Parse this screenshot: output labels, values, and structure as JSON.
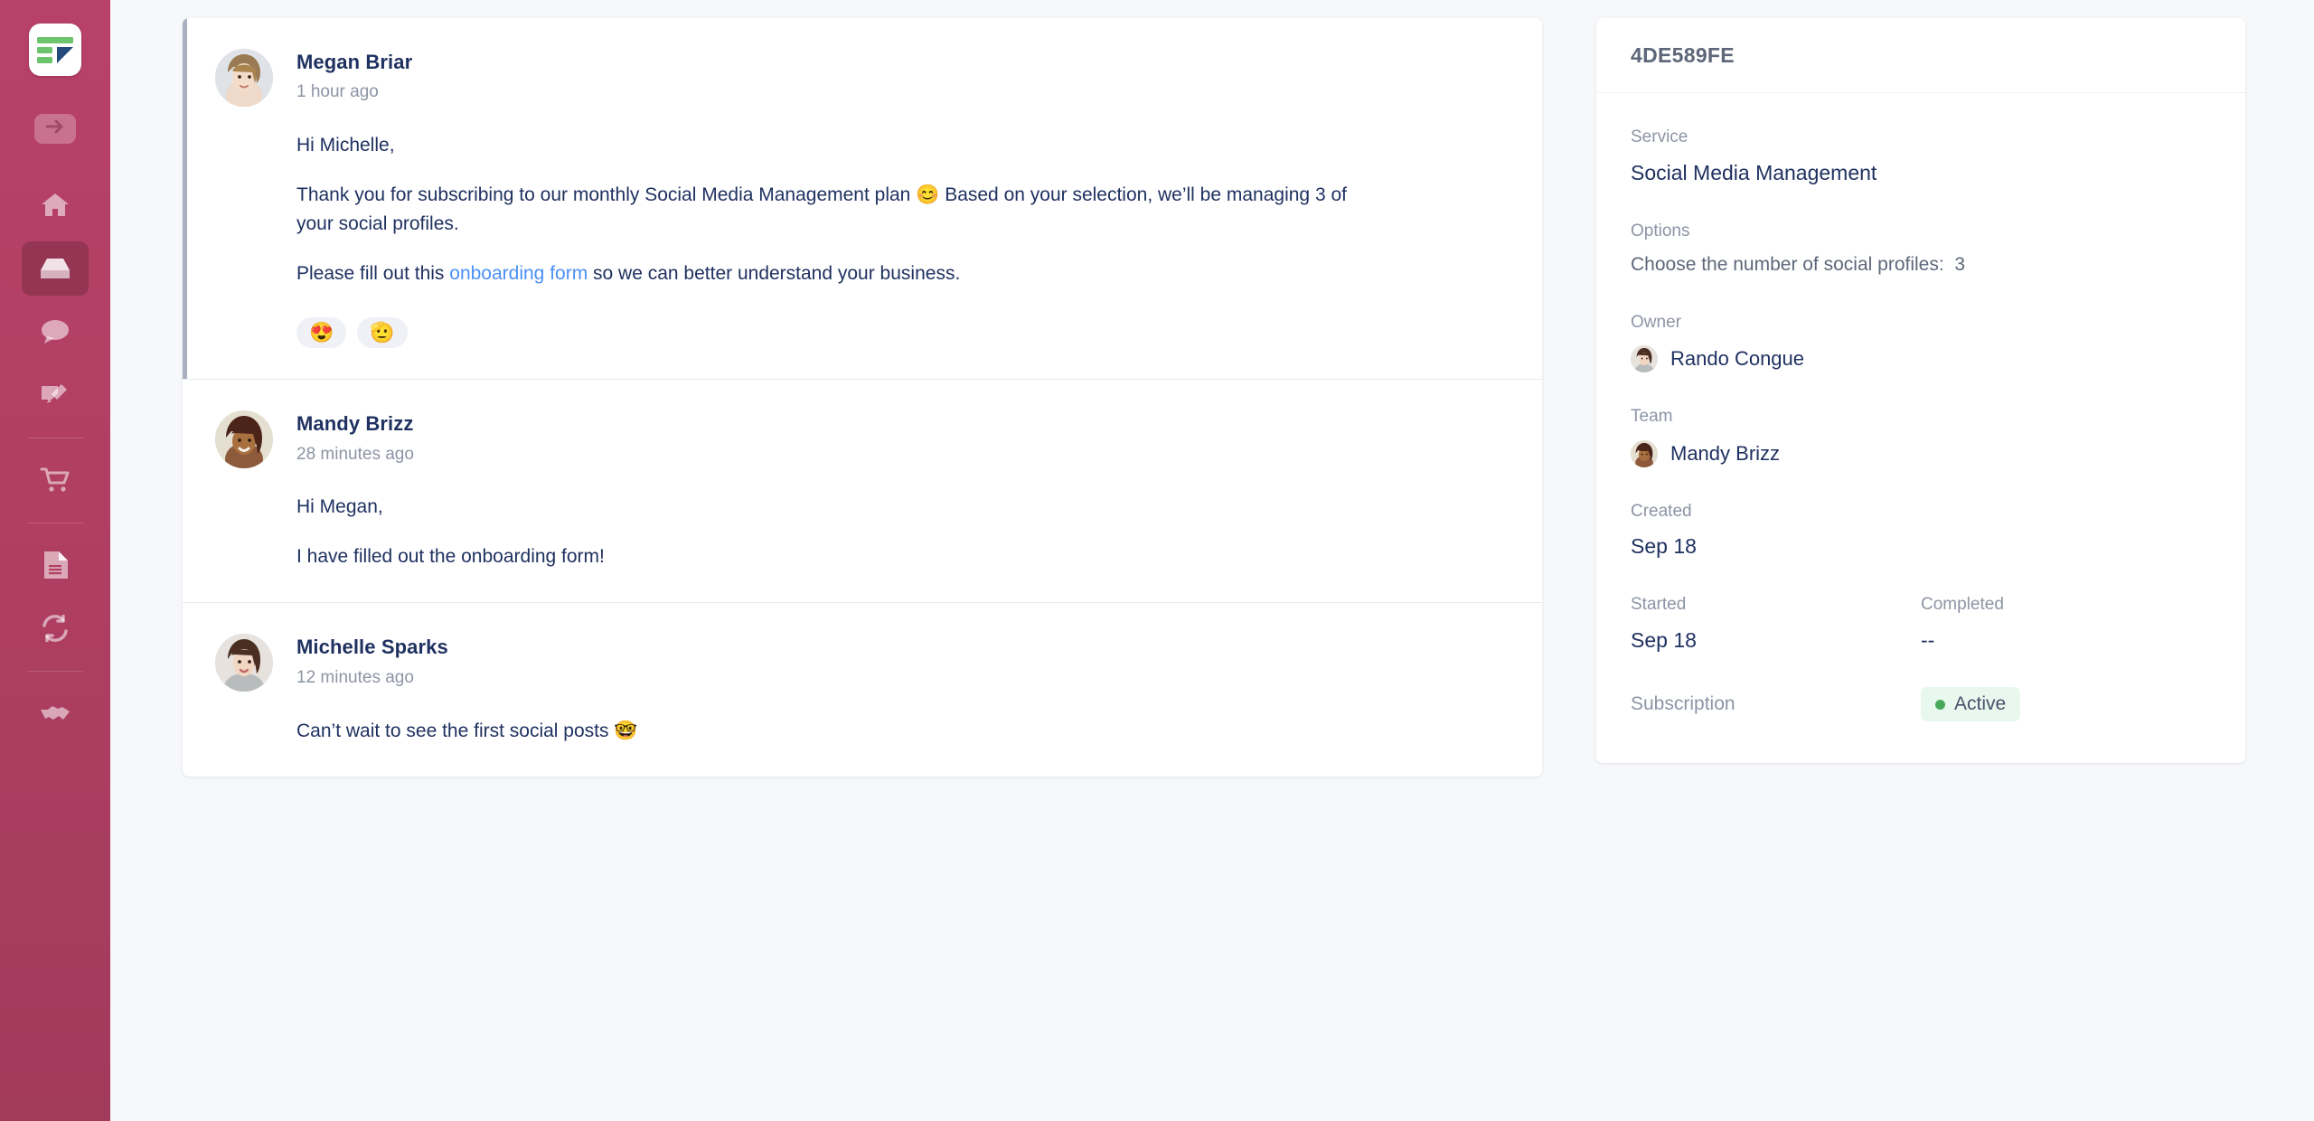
{
  "brand": {
    "accent_sidebar": "#b03f63",
    "logo_green": "#6cc46c",
    "logo_blue": "#23497d",
    "link_blue": "#4a90f4",
    "status_green": "#49a95a",
    "text_navy": "#1f3160"
  },
  "sidebar": {
    "logo_name": "app-logo",
    "items": [
      {
        "icon": "arrow-right-icon",
        "name": "collapse-toggle"
      },
      {
        "icon": "home-icon",
        "name": "sidebar-item-home",
        "active": false
      },
      {
        "icon": "inbox-icon",
        "name": "sidebar-item-inbox",
        "active": true
      },
      {
        "icon": "chat-bubble-icon",
        "name": "sidebar-item-messages",
        "active": false
      },
      {
        "icon": "signature-icon",
        "name": "sidebar-item-forms",
        "active": false
      },
      {
        "icon": "shopping-cart-icon",
        "name": "sidebar-item-orders",
        "active": false
      },
      {
        "icon": "document-icon",
        "name": "sidebar-item-documents",
        "active": false
      },
      {
        "icon": "sync-icon",
        "name": "sidebar-item-subscriptions",
        "active": false
      },
      {
        "icon": "handshake-icon",
        "name": "sidebar-item-partners",
        "active": false
      }
    ]
  },
  "thread": {
    "messages": [
      {
        "author": "Megan Briar",
        "time": "1 hour ago",
        "avatar": "megan-briar-avatar",
        "highlight": true,
        "paragraphs": [
          {
            "text": "Hi Michelle,"
          },
          {
            "prefix": "Thank you for subscribing to our monthly Social Media Management plan ",
            "emoji": "😊",
            "suffix": " Based on your selection, we’ll be managing 3 of your social profiles."
          },
          {
            "prefix": "Please fill out this ",
            "link": "onboarding form",
            "suffix": " so we can better understand your business."
          }
        ],
        "reactions": [
          "😍",
          "🫡"
        ]
      },
      {
        "author": "Mandy Brizz",
        "time": "28 minutes ago",
        "avatar": "mandy-brizz-avatar",
        "highlight": false,
        "paragraphs": [
          {
            "text": "Hi Megan,"
          },
          {
            "text": "I have filled out the onboarding form!"
          }
        ],
        "reactions": []
      },
      {
        "author": "Michelle Sparks",
        "time": "12 minutes ago",
        "avatar": "michelle-sparks-avatar",
        "highlight": false,
        "paragraphs": [
          {
            "prefix": "Can’t wait to see the first social posts ",
            "emoji": "🤓",
            "suffix": ""
          }
        ],
        "reactions": []
      }
    ]
  },
  "panel": {
    "id": "4DE589FE",
    "service_label": "Service",
    "service_value": "Social Media Management",
    "options_label": "Options",
    "options_value": "Choose the number of social profiles:",
    "options_number": "3",
    "owner_label": "Owner",
    "owner_name": "Rando Congue",
    "team_label": "Team",
    "team_name": "Mandy Brizz",
    "created_label": "Created",
    "created_value": "Sep 18",
    "started_label": "Started",
    "started_value": "Sep 18",
    "completed_label": "Completed",
    "completed_value": "--",
    "subscription_label": "Subscription",
    "subscription_status": "Active"
  }
}
